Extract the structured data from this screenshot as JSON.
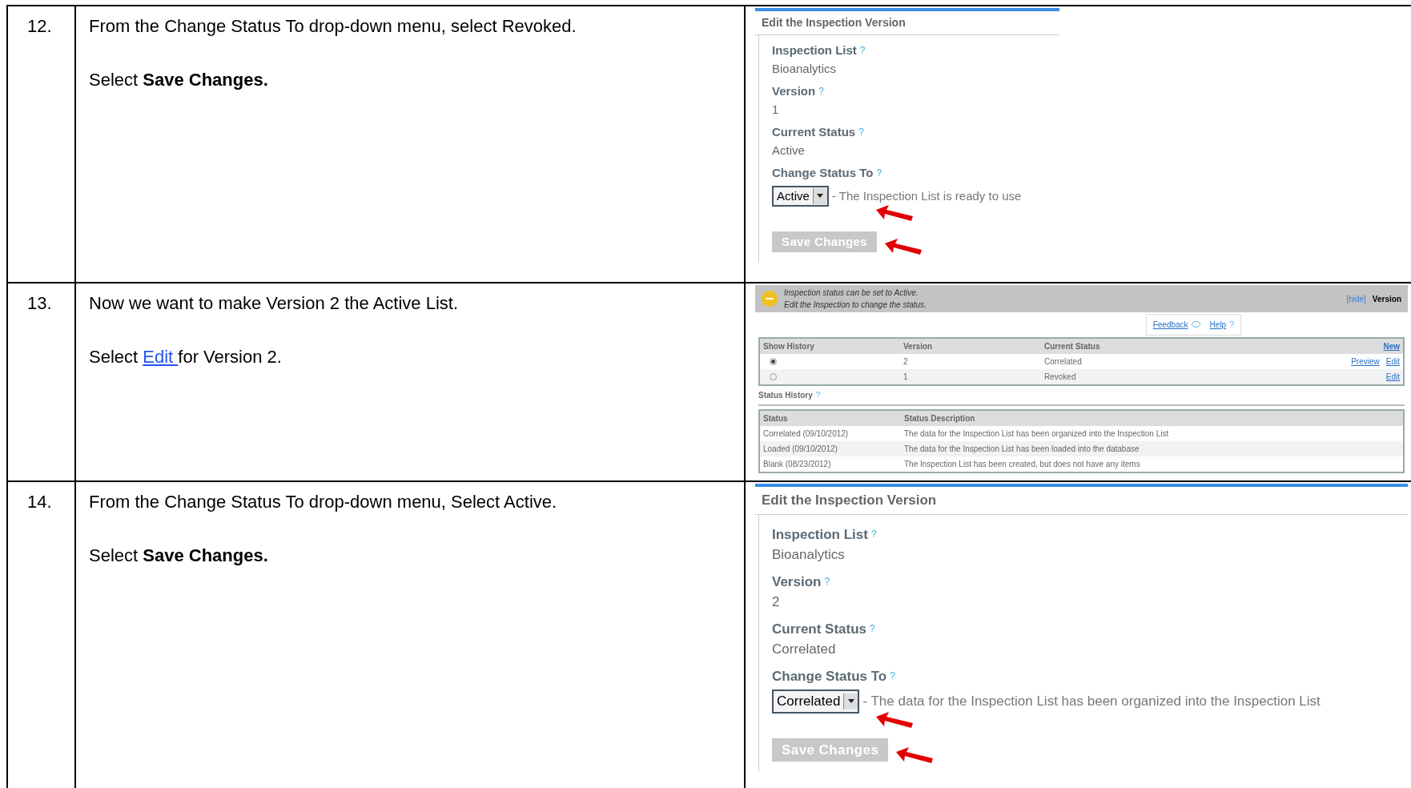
{
  "steps": [
    {
      "number": "12.",
      "paragraphs": [
        [
          {
            "kind": "text",
            "text": "From the Change Status To drop-down menu, select Revoked."
          }
        ],
        [
          {
            "kind": "text",
            "text": "Select **Save Changes.**"
          }
        ]
      ],
      "screenshot": {
        "kind": "edit_form",
        "title": "Edit the Inspection Version",
        "fields": [
          {
            "label": "Inspection List",
            "help": "?",
            "value": "Bioanalytics"
          },
          {
            "label": "Version",
            "help": "?",
            "value": "1"
          },
          {
            "label": "Current Status",
            "help": "?",
            "value": "Active"
          }
        ],
        "change_status": {
          "label": "Change Status To",
          "help": "?",
          "value": "Active",
          "description": "- The Inspection List is ready to use"
        },
        "save_button": "Save Changes"
      }
    },
    {
      "number": "13.",
      "paragraphs": [
        [
          {
            "kind": "text",
            "text": "Now we want to make Version 2 the Active List."
          }
        ],
        [
          {
            "kind": "text",
            "text": "Select "
          },
          {
            "kind": "link",
            "text": "Edit "
          },
          {
            "kind": "text",
            "text": "for Version 2."
          }
        ]
      ],
      "screenshot": {
        "kind": "version_list",
        "banner": {
          "lines": [
            "Inspection status can be set to Active.",
            "Edit the Inspection to change the status."
          ],
          "hide_link": "[hide]",
          "title": "Version"
        },
        "links": [
          {
            "kind": "feedback",
            "text": "Feedback"
          },
          {
            "kind": "help",
            "text": "Help",
            "mark": "?"
          }
        ],
        "versions": {
          "columns": [
            "Show History",
            "Version",
            "Current Status"
          ],
          "new_link": "New",
          "rows": [
            {
              "selected": true,
              "version": "2",
              "status": "Correlated",
              "actions": [
                "Preview",
                "Edit"
              ]
            },
            {
              "selected": false,
              "version": "1",
              "status": "Revoked",
              "actions": [
                "Edit"
              ]
            }
          ]
        },
        "history_title": "Status History",
        "history_help": "?",
        "history": {
          "columns": [
            "Status",
            "Status Description"
          ],
          "rows": [
            [
              "Correlated (09/10/2012)",
              "The data for the Inspection List has been organized into the Inspection List"
            ],
            [
              "Loaded (09/10/2012)",
              "The data for the Inspection List has been loaded into the database"
            ],
            [
              "Blank (08/23/2012)",
              "The Inspection List has been created, but does not have any items"
            ]
          ]
        }
      }
    },
    {
      "number": "14.",
      "paragraphs": [
        [
          {
            "kind": "text",
            "text": "From the Change Status To drop-down menu, Select Active."
          }
        ],
        [
          {
            "kind": "text",
            "text": "Select **Save Changes.**"
          }
        ]
      ],
      "screenshot": {
        "kind": "edit_form",
        "title": "Edit the Inspection Version",
        "fields": [
          {
            "label": "Inspection List",
            "help": "?",
            "value": "Bioanalytics"
          },
          {
            "label": "Version",
            "help": "?",
            "value": "2"
          },
          {
            "label": "Current Status",
            "help": "?",
            "value": "Correlated"
          }
        ],
        "change_status": {
          "label": "Change Status To",
          "help": "?",
          "value": "Correlated",
          "description": "- The data for the Inspection List has been organized into the Inspection List"
        },
        "save_button": "Save Changes"
      }
    }
  ]
}
